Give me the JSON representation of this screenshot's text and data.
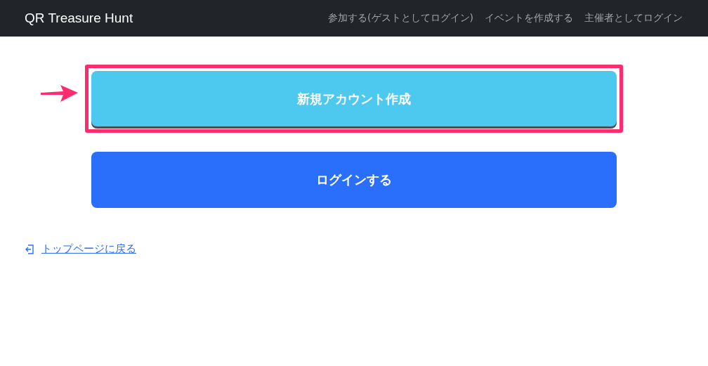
{
  "navbar": {
    "brand": "QR Treasure Hunt",
    "links": [
      "参加する(ゲストとしてログイン)",
      "イベントを作成する",
      "主催者としてログイン"
    ]
  },
  "buttons": [
    {
      "label": "新規アカウント作成",
      "kind": "secondary",
      "highlighted": true
    },
    {
      "label": "ログインする",
      "kind": "primary",
      "highlighted": false
    }
  ],
  "back_link": "トップページに戻る"
}
